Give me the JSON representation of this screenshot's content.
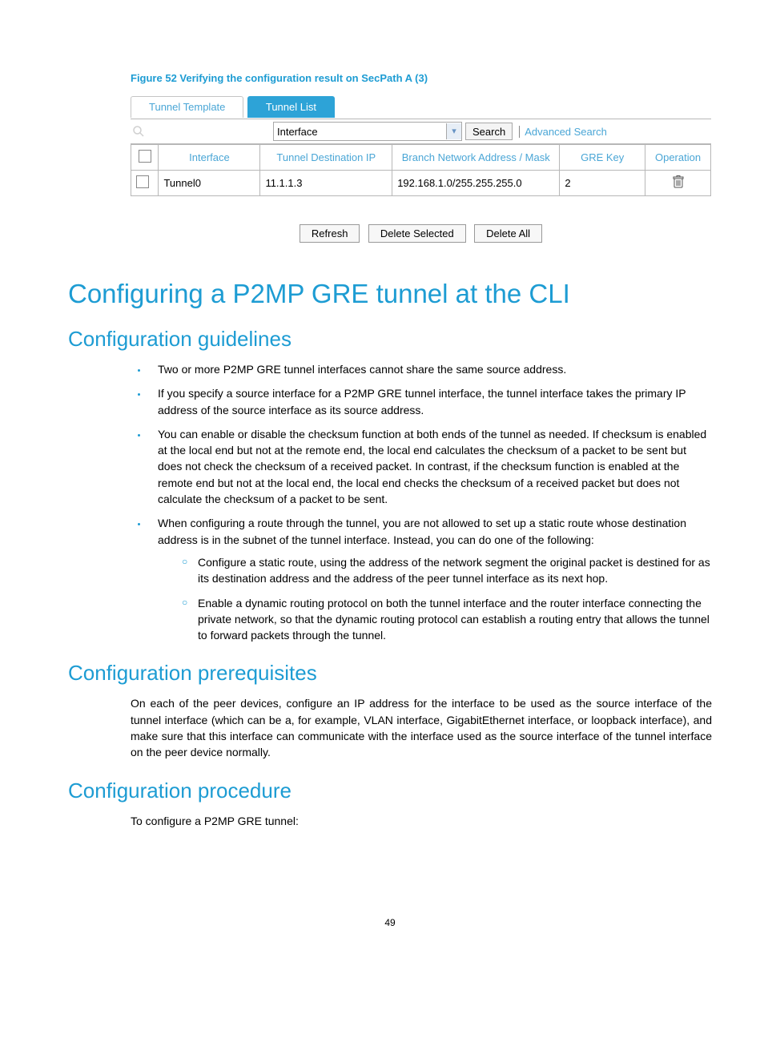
{
  "figure_caption": "Figure 52 Verifying the configuration result on SecPath A (3)",
  "tabs": {
    "template": "Tunnel Template",
    "list": "Tunnel List"
  },
  "filter": {
    "interface_label": "Interface",
    "search_btn": "Search",
    "advanced_search": "Advanced Search"
  },
  "table": {
    "headers": {
      "interface": "Interface",
      "dest": "Tunnel Destination IP",
      "branch": "Branch Network Address / Mask",
      "key": "GRE Key",
      "op": "Operation"
    },
    "rows": [
      {
        "interface": "Tunnel0",
        "dest": "11.1.1.3",
        "branch": "192.168.1.0/255.255.255.0",
        "key": "2"
      }
    ]
  },
  "buttons": {
    "refresh": "Refresh",
    "delete_selected": "Delete Selected",
    "delete_all": "Delete All"
  },
  "h1": "Configuring a P2MP GRE tunnel at the CLI",
  "sections": {
    "guidelines": {
      "title": "Configuration guidelines",
      "bullets": [
        "Two or more P2MP GRE tunnel interfaces cannot share the same source address.",
        "If you specify a source interface for a P2MP GRE tunnel interface, the tunnel interface takes the primary IP address of the source interface as its source address.",
        "You can enable or disable the checksum function at both ends of the tunnel as needed. If checksum is enabled at the local end but not at the remote end, the local end calculates the checksum of a packet to be sent but does not check the checksum of a received packet. In contrast, if the checksum function is enabled at the remote end but not at the local end, the local end checks the checksum of a received packet but does not calculate the checksum of a packet to be sent.",
        "When configuring a route through the tunnel, you are not allowed to set up a static route whose destination address is in the subnet of the tunnel interface. Instead, you can do one of the following:"
      ],
      "subbullets": [
        "Configure a static route, using the address of the network segment the original packet is destined for as its destination address and the address of the peer tunnel interface as its next hop.",
        "Enable a dynamic routing protocol on both the tunnel interface and the router interface connecting the private network, so that the dynamic routing protocol can establish a routing entry that allows the tunnel to forward packets through the tunnel."
      ]
    },
    "prereq": {
      "title": "Configuration prerequisites",
      "text": "On each of the peer devices, configure an IP address for the interface to be used as the source interface of the tunnel interface (which can be a, for example, VLAN interface, GigabitEthernet interface, or loopback interface), and make sure that this interface can communicate with the interface used as the source interface of the tunnel interface on the peer device normally."
    },
    "procedure": {
      "title": "Configuration procedure",
      "text": "To configure a P2MP GRE tunnel:"
    }
  },
  "page_number": "49"
}
